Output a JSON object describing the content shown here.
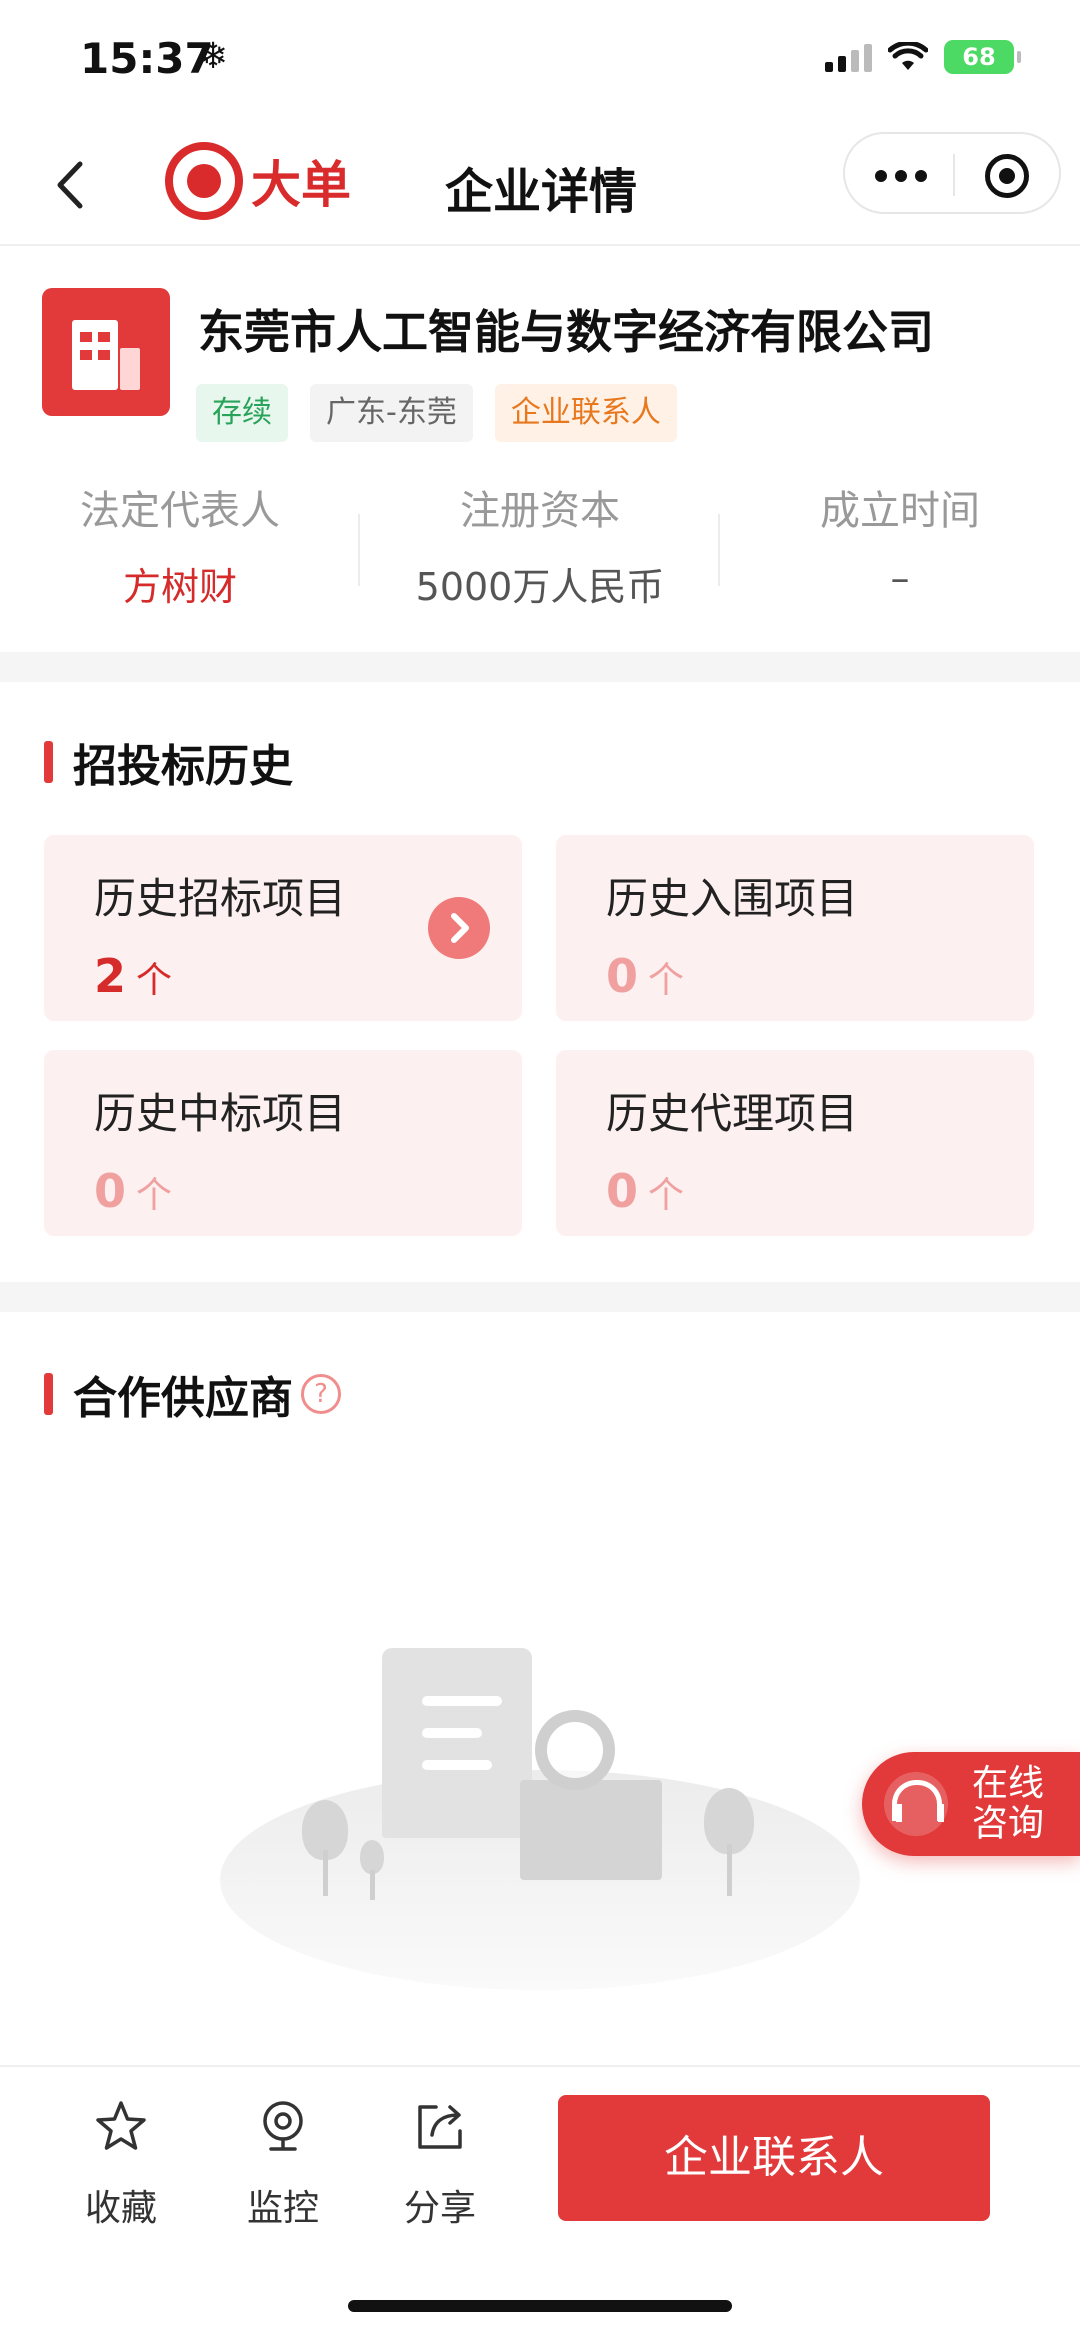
{
  "status_bar": {
    "time": "15:37",
    "battery": "68"
  },
  "nav": {
    "logo_text": "大单",
    "title": "企业详情"
  },
  "company": {
    "name": "东莞市人工智能与数字经济有限公司",
    "tags": [
      "存续",
      "广东-东莞",
      "企业联系人"
    ],
    "stats": [
      {
        "label": "法定代表人",
        "value": "方树财"
      },
      {
        "label": "注册资本",
        "value": "5000万人民币"
      },
      {
        "label": "成立时间",
        "value": "–"
      }
    ]
  },
  "bidding": {
    "title": "招投标历史",
    "cards": [
      {
        "label": "历史招标项目",
        "count": "2",
        "unit": "个"
      },
      {
        "label": "历史入围项目",
        "count": "0",
        "unit": "个"
      },
      {
        "label": "历史中标项目",
        "count": "0",
        "unit": "个"
      },
      {
        "label": "历史代理项目",
        "count": "0",
        "unit": "个"
      }
    ]
  },
  "suppliers": {
    "title": "合作供应商"
  },
  "consult": {
    "line1": "在线",
    "line2": "咨询"
  },
  "bottom": {
    "favorite": "收藏",
    "monitor": "监控",
    "share": "分享",
    "contact_button": "企业联系人"
  },
  "colors": {
    "accent": "#e2393a",
    "card_bg": "#fdf0f0"
  },
  "icons": [
    "back-icon",
    "more-icon",
    "target-icon",
    "star-icon",
    "camera-icon",
    "share-icon",
    "headset-icon",
    "help-icon",
    "chevron-right-icon"
  ]
}
